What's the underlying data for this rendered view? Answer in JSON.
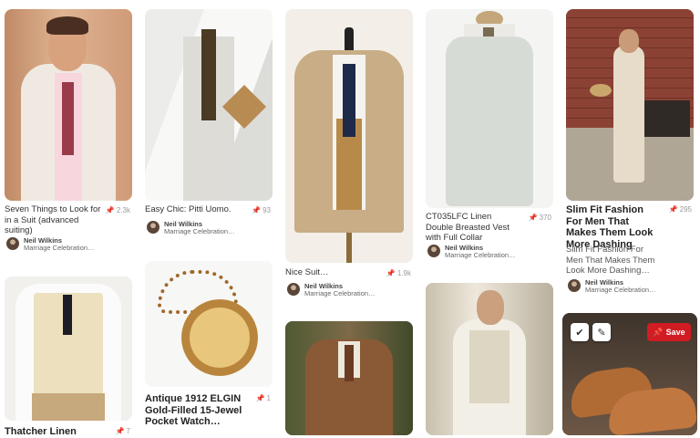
{
  "pins": [
    {
      "title": "Seven Things to Look for in a Suit (advanced suiting)",
      "repins": "2.3k",
      "author": "Neil Wilkins",
      "board": "Marriage Celebration…"
    },
    {
      "title": "Easy Chic: Pitti Uomo.",
      "repins": "93",
      "author": "Neil Wilkins",
      "board": "Marriage Celebration…"
    },
    {
      "title": "Nice Suit…",
      "repins": "1.9k",
      "author": "Neil Wilkins",
      "board": "Marriage Celebration…"
    },
    {
      "title": "CT035LFC Linen Double Breasted Vest with Full Collar",
      "repins": "370",
      "author": "Neil Wilkins",
      "board": "Marriage Celebration…"
    },
    {
      "title": "Slim Fit Fashion For Men That Makes Them Look More Dashing",
      "repins": "295",
      "description": "Slim Fit Fashion For Men That Makes Them Look More Dashing…",
      "author": "Neil Wilkins",
      "board": "Marriage Celebration…"
    },
    {
      "title": "Thatcher Linen",
      "repins": "7"
    },
    {
      "title": "Antique 1912 ELGIN Gold-Filled 15-Jewel Pocket Watch…",
      "repins": "1"
    }
  ],
  "overlay": {
    "save_label": "Save"
  },
  "icons": {
    "pin": "pushpin-icon",
    "check": "checkmark-icon",
    "edit": "pencil-icon",
    "save": "pushpin-icon"
  },
  "colors": {
    "save": "#d01c22"
  }
}
